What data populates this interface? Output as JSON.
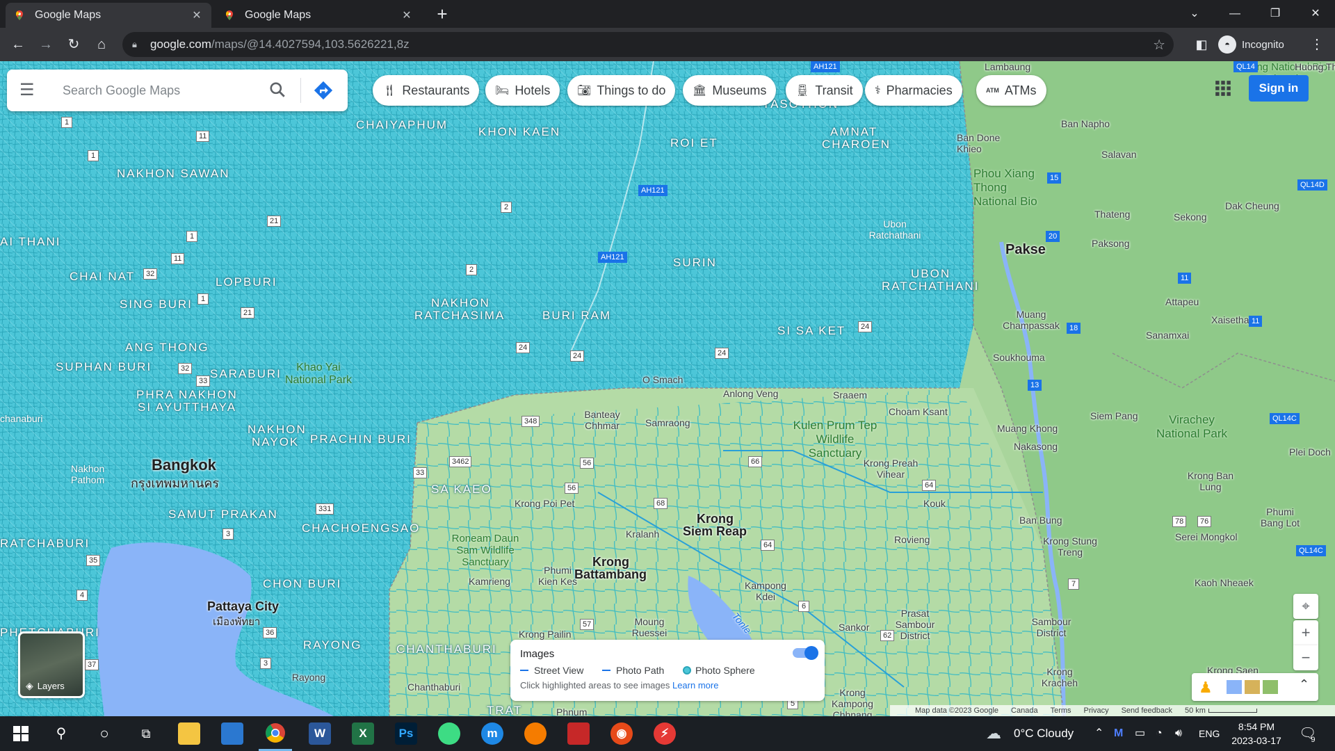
{
  "browser": {
    "tabs": [
      {
        "title": "Google Maps",
        "active": true
      },
      {
        "title": "Google Maps",
        "active": false
      }
    ],
    "url_host": "google.com",
    "url_path": "/maps/@14.4027594,103.5626221,8z",
    "profile_label": "Incognito"
  },
  "maps": {
    "search_placeholder": "Search Google Maps",
    "chips": [
      "Restaurants",
      "Hotels",
      "Things to do",
      "Museums",
      "Transit",
      "Pharmacies",
      "ATMs"
    ],
    "sign_in": "Sign in",
    "layers_label": "Layers",
    "images_card": {
      "title": "Images",
      "street_view": "Street View",
      "photo_path": "Photo Path",
      "photo_sphere": "Photo Sphere",
      "hint": "Click highlighted areas to see images",
      "learn_more": "Learn more",
      "toggle_on": true
    },
    "attribution": {
      "map_data": "Map data ©2023 Google",
      "country": "Canada",
      "terms": "Terms",
      "privacy": "Privacy",
      "feedback": "Send feedback",
      "scale": "50 km"
    },
    "labels": {
      "nakhon_sawan": "NAKHON SAWAN",
      "chaiyaphum": "CHAIYAPHUM",
      "khon_kaen": "KHON KAEN",
      "roi_et": "ROI ET",
      "amnat": "AMNAT",
      "charoen": "CHAROEN",
      "yasothon": "YASOTHON",
      "ai_thani": "AI THANI",
      "chai_nat": "CHAI NAT",
      "lopburi": "LOPBURI",
      "sing_buri": "SING BURI",
      "ang_thong": "ANG THONG",
      "suphan_buri": "SUPHAN BURI",
      "saraburi": "SARABURI",
      "phra_nakhon": "PHRA NAKHON",
      "si_ayutthaya": "SI AYUTTHAYA",
      "nakhon_ratchasima_1": "NAKHON",
      "nakhon_ratchasima_2": "RATCHASIMA",
      "buri_ram": "BURI RAM",
      "surin": "SURIN",
      "si_sa_ket": "SI SA KET",
      "ubon_1": "UBON",
      "ubon_2": "RATCHATHANI",
      "nakhon_nayok_1": "NAKHON",
      "nakhon_nayok_2": "NAYOK",
      "prachin_buri": "PRACHIN BURI",
      "sa_kaeo": "SA KAEO",
      "samut_prakan": "SAMUT PRAKAN",
      "chachoengsao": "CHACHOENGSAO",
      "chon_buri": "CHON BURI",
      "rayong": "RAYONG",
      "chanthaburi": "CHANTHABURI",
      "ratchaburi": "RATCHABURI",
      "phetchaburi": "PHETCHABURI",
      "trat": "TRAT",
      "bangkok": "Bangkok",
      "bangkok_th": "กรุงเทพมหานคร",
      "pakse": "Pakse",
      "pattaya": "Pattaya City",
      "pattaya_th": "เมืองพัทยา",
      "krong_siem_reap_1": "Krong",
      "krong_siem_reap_2": "Siem Reap",
      "krong_battambang_1": "Krong",
      "krong_battambang_2": "Battambang",
      "khao_yai": "Khao Yai National Park",
      "kulen_prum": "Kulen Prum Tep Wildlife Sanctuary",
      "phou_xiang": "Phou Xiang Thong National Bio",
      "virachey": "Virachey National Park",
      "roneam": "Roneam Daun Sam Wildlife Sanctuary",
      "nakhon_pathom": "Nakhon Pathom",
      "chanaburi": "chanaburi",
      "lambaung": "Lambaung",
      "ban_napho": "Ban Napho",
      "ban_done": "Ban Done Khieo",
      "salavan": "Salavan",
      "dak_cheung": "Dak Cheung",
      "thateng": "Thateng",
      "sekong": "Sekong",
      "paksong": "Paksong",
      "attapeu": "Attapeu",
      "xaisetha": "Xaisetha",
      "sanamxai": "Sanamxai",
      "mujang_champassak": "Muang Champassak",
      "soukhouma": "Soukhouma",
      "muang_khong": "Muang Khong",
      "nakasong": "Nakasong",
      "siem_pang": "Siem Pang",
      "choam_ksant": "Choam Ksant",
      "sraaem": "Sraaem",
      "anlong_veng": "Anlong Veng",
      "o_smach": "O Smach",
      "samraong": "Samraong",
      "banteay_chhmar": "Banteay Chhmar",
      "krong_preah_vihear": "Krong Preah Vihear",
      "kouk": "Kouk",
      "ban_bung": "Ban Bung",
      "krong_stung_treng": "Krong Stung Treng",
      "serei_mongkol": "Serei Mongkol",
      "phumi_bang_lot": "Phumi Bang Lot",
      "krong_ban_lung": "Krong Ban Lung",
      "kaoh_nheaek": "Kaoh Nheaek",
      "rovieng": "Rovieng",
      "kampong_kdei": "Kampong Kdei",
      "krong_poi_pet": "Krong Poi Pet",
      "kralanh": "Kralanh",
      "phumi_kien_kes": "Phumi Kien Kes",
      "kamrieng": "Kamrieng",
      "moung_ruessei": "Moung Ruessei",
      "krong_pailin": "Krong Pailin",
      "prasat_sambour": "Prasat Sambour District",
      "sambour_district": "Sambour District",
      "krong_kracheh": "Krong Kracheh",
      "krong_saen": "Krong Saen",
      "sankor": "Sankor",
      "krong_kampong_chhnang": "Krong Kampong Chhnang",
      "plei_doch": "Plei Doch",
      "huong_th": "Huong Th",
      "phnum": "Phnum",
      "rayong_town": "Rayong",
      "chanthaburi_town": "Chanthaburi",
      "vieng_nat": "Vieng National Bio-Diversity",
      "ubon_town": "Ubon Ratchathani",
      "tonle": "Tonle"
    },
    "shields": [
      "1",
      "11",
      "1",
      "21",
      "11",
      "1",
      "32",
      "1",
      "21",
      "2",
      "2",
      "24",
      "24",
      "24",
      "24",
      "33",
      "32",
      "348",
      "3462",
      "56",
      "56",
      "66",
      "68",
      "64",
      "64",
      "331",
      "3",
      "35",
      "36",
      "3",
      "37",
      "57",
      "6",
      "62",
      "5",
      "4",
      "33",
      "AH121",
      "AH121",
      "AH121",
      "15",
      "20",
      "11",
      "18",
      "11",
      "13",
      "QL14",
      "QL14D",
      "QL14C",
      "QL14C",
      "7",
      "78",
      "76"
    ]
  },
  "taskbar": {
    "weather": "0°C  Cloudy",
    "lang": "ENG",
    "time": "8:54 PM",
    "date": "2023-03-17",
    "notif_count": "9"
  }
}
